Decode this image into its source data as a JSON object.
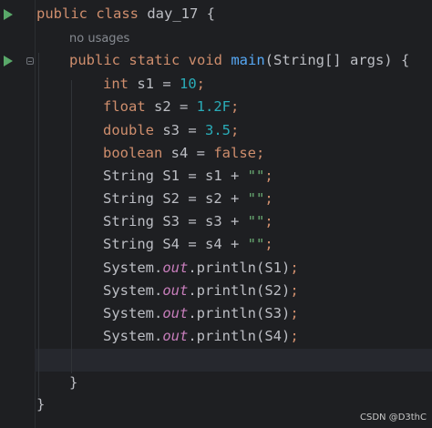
{
  "editor": {
    "lines": [
      {
        "tokens": [
          {
            "t": "public ",
            "c": "kw"
          },
          {
            "t": "class ",
            "c": "kw"
          },
          {
            "t": "day_17 {",
            "c": ""
          }
        ]
      },
      {
        "hint": "no usages"
      },
      {
        "tokens": [
          {
            "t": "public ",
            "c": "kw"
          },
          {
            "t": "static ",
            "c": "kw"
          },
          {
            "t": "void ",
            "c": "kw"
          },
          {
            "t": "main",
            "c": "fn"
          },
          {
            "t": "(String[] args) {",
            "c": ""
          }
        ]
      },
      {
        "tokens": [
          {
            "t": "int ",
            "c": "kw"
          },
          {
            "t": "s1 = ",
            "c": ""
          },
          {
            "t": "10",
            "c": "num"
          },
          {
            "t": ";",
            "c": "kw"
          }
        ]
      },
      {
        "tokens": [
          {
            "t": "float ",
            "c": "kw"
          },
          {
            "t": "s2 = ",
            "c": ""
          },
          {
            "t": "1.2F",
            "c": "num"
          },
          {
            "t": ";",
            "c": "kw"
          }
        ]
      },
      {
        "tokens": [
          {
            "t": "double ",
            "c": "kw"
          },
          {
            "t": "s3 = ",
            "c": ""
          },
          {
            "t": "3.5",
            "c": "num"
          },
          {
            "t": ";",
            "c": "kw"
          }
        ]
      },
      {
        "tokens": [
          {
            "t": "boolean ",
            "c": "kw"
          },
          {
            "t": "s4 = ",
            "c": ""
          },
          {
            "t": "false",
            "c": "kw"
          },
          {
            "t": ";",
            "c": "kw"
          }
        ]
      },
      {
        "tokens": [
          {
            "t": "String S1 = s1 + ",
            "c": ""
          },
          {
            "t": "\"\"",
            "c": "str"
          },
          {
            "t": ";",
            "c": "kw"
          }
        ]
      },
      {
        "tokens": [
          {
            "t": "String S2 = s2 + ",
            "c": ""
          },
          {
            "t": "\"\"",
            "c": "str"
          },
          {
            "t": ";",
            "c": "kw"
          }
        ]
      },
      {
        "tokens": [
          {
            "t": "String S3 = s3 + ",
            "c": ""
          },
          {
            "t": "\"\"",
            "c": "str"
          },
          {
            "t": ";",
            "c": "kw"
          }
        ]
      },
      {
        "tokens": [
          {
            "t": "String S4 = s4 + ",
            "c": ""
          },
          {
            "t": "\"\"",
            "c": "str"
          },
          {
            "t": ";",
            "c": "kw"
          }
        ]
      },
      {
        "tokens": [
          {
            "t": "System.",
            "c": ""
          },
          {
            "t": "out",
            "c": "fld"
          },
          {
            "t": ".println(S1)",
            "c": ""
          },
          {
            "t": ";",
            "c": "kw"
          }
        ]
      },
      {
        "tokens": [
          {
            "t": "System.",
            "c": ""
          },
          {
            "t": "out",
            "c": "fld"
          },
          {
            "t": ".println(S2)",
            "c": ""
          },
          {
            "t": ";",
            "c": "kw"
          }
        ]
      },
      {
        "tokens": [
          {
            "t": "System.",
            "c": ""
          },
          {
            "t": "out",
            "c": "fld"
          },
          {
            "t": ".println(S3)",
            "c": ""
          },
          {
            "t": ";",
            "c": "kw"
          }
        ]
      },
      {
        "tokens": [
          {
            "t": "System.",
            "c": ""
          },
          {
            "t": "out",
            "c": "fld"
          },
          {
            "t": ".println(S4)",
            "c": ""
          },
          {
            "t": ";",
            "c": "kw"
          }
        ]
      },
      {
        "tokens": []
      },
      {
        "tokens": [
          {
            "t": "}",
            "c": ""
          }
        ]
      },
      {
        "tokens": [
          {
            "t": "}",
            "c": ""
          }
        ]
      }
    ],
    "icons": {
      "run": "run-icon",
      "fold": "fold-icon"
    }
  },
  "watermark": "CSDN @D3thC"
}
